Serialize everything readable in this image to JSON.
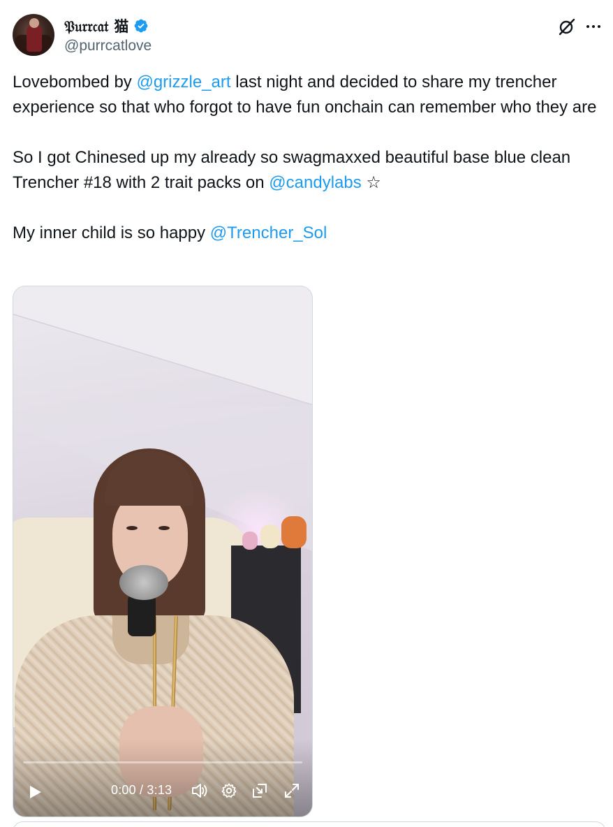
{
  "author": {
    "display_name": "𝔓𝔲𝔯𝔯𝔠𝔞𝔱 猫",
    "handle": "@purrcatlove",
    "verified": true
  },
  "tweet": {
    "paragraph1": [
      {
        "type": "text",
        "value": "Lovebombed by "
      },
      {
        "type": "mention",
        "value": "@grizzle_art"
      },
      {
        "type": "text",
        "value": " last night and decided to share my trencher experience so that who forgot to have fun onchain can remember who they are"
      }
    ],
    "paragraph2": [
      {
        "type": "text",
        "value": "So I got Chinesed up my already so swagmaxxed beautiful base blue clean Trencher #18 with 2 trait packs on "
      },
      {
        "type": "mention",
        "value": "@candylabs"
      },
      {
        "type": "text",
        "value": " ☆"
      }
    ],
    "paragraph3": [
      {
        "type": "text",
        "value": "My inner child is so happy "
      },
      {
        "type": "mention",
        "value": "@Trencher_Sol"
      }
    ]
  },
  "video": {
    "time_display": "0:00 / 3:13",
    "progress_fraction": 0.0
  },
  "icons": {
    "grok": "grok-icon",
    "more": "more-icon",
    "verified": "verified-badge-icon",
    "play": "play-icon",
    "volume": "volume-icon",
    "settings": "settings-icon",
    "pip": "picture-in-picture-icon",
    "fullscreen": "fullscreen-icon"
  },
  "colors": {
    "link": "#1d9bf0",
    "text": "#0f1419",
    "secondary": "#536471",
    "verified": "#1d9bf0"
  }
}
